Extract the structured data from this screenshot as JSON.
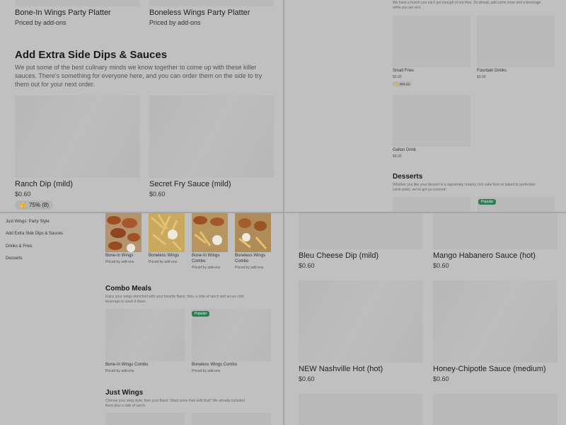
{
  "q1": {
    "top_items": [
      {
        "name": "Bone-In Wings Party Platter",
        "price": "Priced by add-ons"
      },
      {
        "name": "Boneless Wings Party Platter",
        "price": "Priced by add-ons"
      }
    ],
    "section_title": "Add Extra Side Dips & Sauces",
    "section_desc": "We put some of the best culinary minds we know together to come up with these killer sauces. There's something for everyone here, and you can order them on the side to try them out for your next order.",
    "items": [
      {
        "name": "Ranch Dip (mild)",
        "price": "$0.60",
        "rating": "75% (8)"
      },
      {
        "name": "Secret Fry Sauce (mild)",
        "price": "$0.60"
      }
    ]
  },
  "q2": {
    "top_desc_1": "We have a hunch you can't get enough of our fries. So ahead, add some more and a beverage",
    "top_desc_2": "while you are at it.",
    "items": [
      {
        "name": "Small Fries",
        "price": "$3.00",
        "rating": "96% (3)"
      },
      {
        "name": "Fountain Drinks",
        "price": "$3.00"
      },
      {
        "name": "Gallon Drink",
        "price": "$8.00"
      }
    ],
    "desserts_title": "Desserts",
    "desserts_desc_1": "Whether you like your dessert in a supremely creamy, rich cake form or baked to perfection",
    "desserts_desc_2": "(wink wink), we've got ya covered!",
    "badge": "Popular"
  },
  "q3": {
    "nav": [
      "Just Wings: Party Style",
      "Add Extra Side Dips & Sauces",
      "Drinks & Fries",
      "Desserts"
    ],
    "carousel": [
      {
        "name_1": "Bone-In Wings",
        "name_2": "",
        "price": "Priced by add-ons"
      },
      {
        "name_1": "Boneless Wings",
        "name_2": "",
        "price": "Priced by add-ons"
      },
      {
        "name_1": "Bone-In Wings",
        "name_2": "Combo",
        "price": "Priced by add-ons"
      },
      {
        "name_1": "Boneless Wings",
        "name_2": "Combo",
        "price": "Priced by add-ons"
      }
    ],
    "combo_title": "Combo Meals",
    "combo_desc_1": "Enjoy your wings drenched with your favorite flavor, fries, a side of ranch and an ice cold",
    "combo_desc_2": "beverage to wash it down.",
    "combo_items": [
      {
        "name": "Bone-In Wings Combo",
        "price": "Priced by add-ons"
      },
      {
        "name": "Boneless Wings Combo",
        "price": "Priced by add-ons"
      }
    ],
    "badge": "Popular",
    "just_title": "Just Wings",
    "just_desc_1": "Choose your wing style, then your flavor. Want some fries with that? We already included",
    "just_desc_2": "them plus a side of ranch."
  },
  "q4": {
    "items": [
      {
        "name": "Bleu Cheese Dip (mild)",
        "price": "$0.60"
      },
      {
        "name": "Mango Habanero Sauce (hot)",
        "price": "$0.60"
      },
      {
        "name": "NEW Nashville Hot (hot)",
        "price": "$0.60"
      },
      {
        "name": "Honey-Chipotle Sauce (medium)",
        "price": "$0.60"
      }
    ]
  }
}
